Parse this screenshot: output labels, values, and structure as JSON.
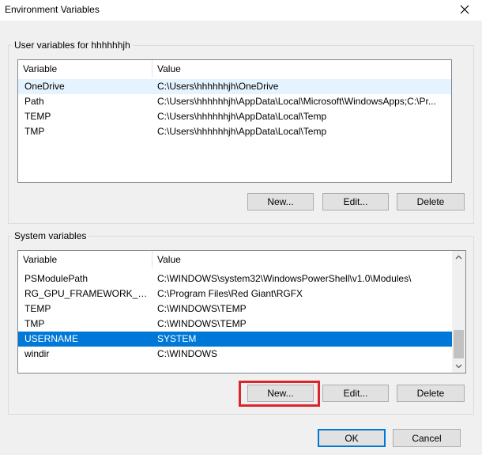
{
  "window": {
    "title": "Environment Variables"
  },
  "user_vars": {
    "label": "User variables for hhhhhhjh",
    "columns": [
      "Variable",
      "Value"
    ],
    "rows": [
      {
        "variable": "OneDrive",
        "value": "C:\\Users\\hhhhhhjh\\OneDrive"
      },
      {
        "variable": "Path",
        "value": "C:\\Users\\hhhhhhjh\\AppData\\Local\\Microsoft\\WindowsApps;C:\\Pr..."
      },
      {
        "variable": "TEMP",
        "value": "C:\\Users\\hhhhhhjh\\AppData\\Local\\Temp"
      },
      {
        "variable": "TMP",
        "value": "C:\\Users\\hhhhhhjh\\AppData\\Local\\Temp"
      }
    ],
    "buttons": {
      "new": "New...",
      "edit": "Edit...",
      "delete": "Delete"
    }
  },
  "system_vars": {
    "label": "System variables",
    "columns": [
      "Variable",
      "Value"
    ],
    "rows": [
      {
        "variable": "PSModulePath",
        "value": "C:\\WINDOWS\\system32\\WindowsPowerShell\\v1.0\\Modules\\"
      },
      {
        "variable": "RG_GPU_FRAMEWORK_ENGI...",
        "value": "C:\\Program Files\\Red Giant\\RGFX"
      },
      {
        "variable": "TEMP",
        "value": "C:\\WINDOWS\\TEMP"
      },
      {
        "variable": "TMP",
        "value": "C:\\WINDOWS\\TEMP"
      },
      {
        "variable": "USERNAME",
        "value": "SYSTEM"
      },
      {
        "variable": "windir",
        "value": "C:\\WINDOWS"
      }
    ],
    "selected_variable": "USERNAME",
    "buttons": {
      "new": "New...",
      "edit": "Edit...",
      "delete": "Delete"
    }
  },
  "footer": {
    "ok": "OK",
    "cancel": "Cancel"
  },
  "colors": {
    "selection": "#0078d7",
    "highlight_box": "#d8262c",
    "hover": "#e5f3ff"
  },
  "icons": {
    "close": "close-icon",
    "scroll_up": "chevron-up-icon",
    "scroll_down": "chevron-down-icon"
  }
}
